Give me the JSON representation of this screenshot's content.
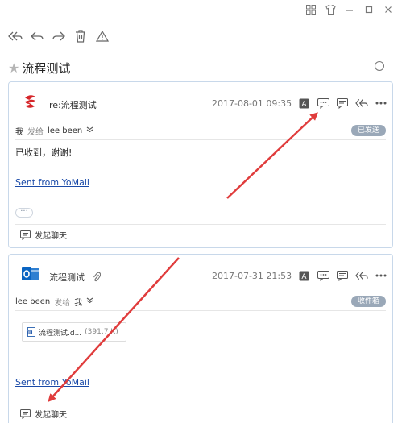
{
  "window": {
    "controls": [
      "grid-icon",
      "shirt-icon",
      "minimize-icon",
      "maximize-icon",
      "close-icon"
    ]
  },
  "toolbar": {
    "icons": [
      "reply-all-icon",
      "reply-icon",
      "forward-icon",
      "trash-icon",
      "warning-icon"
    ]
  },
  "thread": {
    "subject": "流程测试"
  },
  "messages": [
    {
      "subject": "re:流程测试",
      "date": "2017-08-01 09:35",
      "from": "我",
      "sent_to_label": "发给",
      "to": "lee been",
      "badge": "已发送",
      "body_line": "已收到，谢谢!",
      "link": "Sent from YoMail",
      "more_label": "···",
      "chat_label": "发起聊天"
    },
    {
      "subject": "流程测试",
      "date": "2017-07-31 21:53",
      "from": "lee been",
      "sent_to_label": "发给",
      "to": "我",
      "badge": "收件箱",
      "attachment": {
        "name": "流程测试.d...",
        "size": "(391.7 K)"
      },
      "link": "Sent from YoMail",
      "chat_label": "发起聊天"
    }
  ],
  "colors": {
    "annotation_arrow": "#e03c3c",
    "card_border": "#c8d8ea",
    "link": "#1a4aa8"
  }
}
